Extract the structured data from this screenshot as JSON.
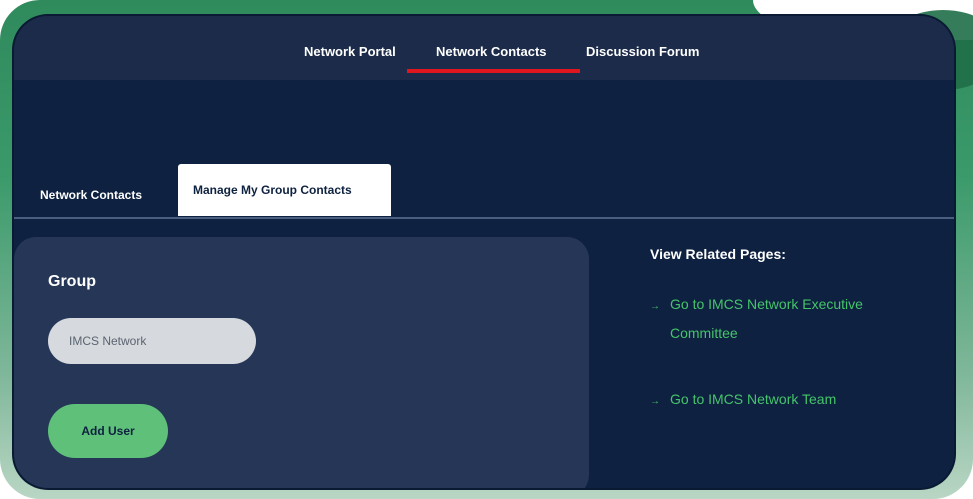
{
  "topnav": {
    "items": [
      {
        "label": "Network Portal"
      },
      {
        "label": "Network Contacts",
        "active": true
      },
      {
        "label": "Discussion Forum"
      }
    ],
    "active_color": "#e0161f"
  },
  "tabs": [
    {
      "label": "Network Contacts",
      "active": false
    },
    {
      "label": "Manage My Group Contacts",
      "active": true
    }
  ],
  "group_panel": {
    "label": "Group",
    "input_value": "IMCS Network",
    "add_button_label": "Add User",
    "button_color": "#5fc07a"
  },
  "related": {
    "title": "View Related Pages:",
    "arrow_icon": "right-arrow-icon",
    "links": [
      {
        "line1": "Go to IMCS Network Executive",
        "line2": "Committee"
      },
      {
        "label": "Go to IMCS Network Team"
      }
    ],
    "link_color": "#45c46b"
  },
  "colors": {
    "app_background": "#0e2140",
    "nav_background": "#1b2b49",
    "frame_green": "#2f8a5c"
  }
}
